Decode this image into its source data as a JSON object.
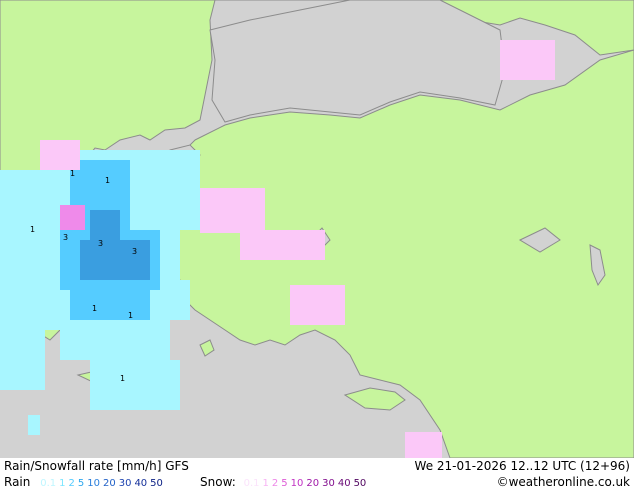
{
  "map": {
    "colors": {
      "sea": "#d2d2d2",
      "land": "#c7f59d",
      "coast": "#8c8c8c",
      "rain_light": "#a8f6ff",
      "rain_mid": "#55ccff",
      "rain_heavy": "#3a9ee0",
      "snow_light": "#fbc8f8",
      "snow_mid": "#ef8aea"
    },
    "cell_labels": [
      "1",
      "1",
      "1",
      "3",
      "3",
      "3",
      "1",
      "1",
      "1"
    ]
  },
  "footer": {
    "title": "Rain/Snowfall rate [mm/h] GFS",
    "datetime": "We 21-01-2026 12..12 UTC (12+96)",
    "rain_label": "Rain",
    "rain_scale": [
      {
        "v": "0.1",
        "c": "#bff6ff"
      },
      {
        "v": "1",
        "c": "#7de6ff"
      },
      {
        "v": "2",
        "c": "#55ccff"
      },
      {
        "v": "5",
        "c": "#2fa8ef"
      },
      {
        "v": "10",
        "c": "#2a7fdc"
      },
      {
        "v": "20",
        "c": "#2463c8"
      },
      {
        "v": "30",
        "c": "#1e44b0"
      },
      {
        "v": "40",
        "c": "#15309a"
      },
      {
        "v": "50",
        "c": "#0a1f84"
      }
    ],
    "snow_label": "Snow:",
    "snow_scale": [
      {
        "v": "0.1",
        "c": "#fbe3fb"
      },
      {
        "v": "1",
        "c": "#f8b4f4"
      },
      {
        "v": "2",
        "c": "#ee88e8"
      },
      {
        "v": "5",
        "c": "#de5ad6"
      },
      {
        "v": "10",
        "c": "#c232c4"
      },
      {
        "v": "20",
        "c": "#a01ca8"
      },
      {
        "v": "30",
        "c": "#83108e"
      },
      {
        "v": "40",
        "c": "#690a76"
      },
      {
        "v": "50",
        "c": "#500660"
      }
    ],
    "credit": "©weatheronline.co.uk"
  }
}
